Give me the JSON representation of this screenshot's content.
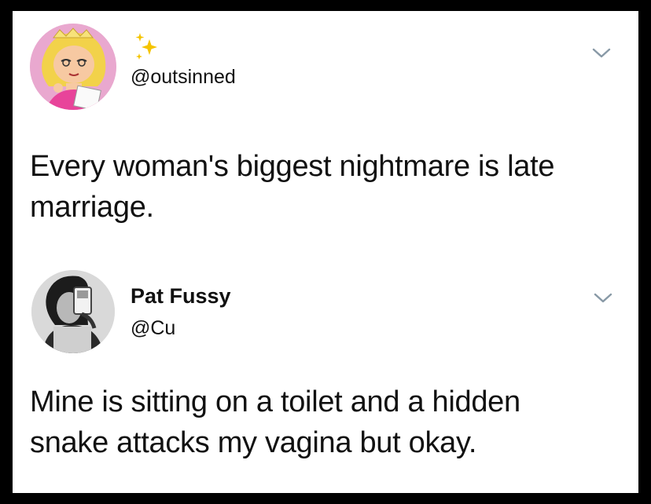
{
  "tweets": [
    {
      "handle": "@outsinned",
      "display_name": "",
      "text_lines": [
        "Every woman's biggest nightmare is late",
        "marriage."
      ],
      "avatar_icon": "cartoon-girl-avatar",
      "badge_icon": "sparkles-icon",
      "menu_icon": "chevron-down-icon"
    },
    {
      "handle": "@Cu",
      "display_name": "Pat Fussy",
      "text_lines": [
        "Mine is sitting on a toilet and a hidden",
        "snake attacks my vagina but okay."
      ],
      "avatar_icon": "mirror-selfie-avatar",
      "menu_icon": "chevron-down-icon"
    }
  ],
  "colors": {
    "border": "#000000",
    "background": "#ffffff",
    "text": "#111111",
    "sparkle": "#f5c400",
    "chevron": "#8899a6"
  }
}
